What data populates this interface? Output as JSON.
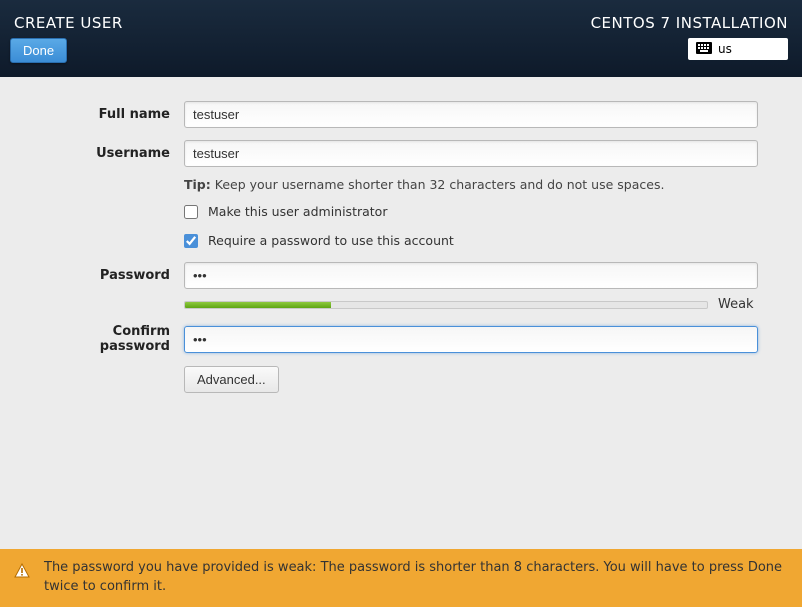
{
  "header": {
    "title": "CREATE USER",
    "subtitle": "CENTOS 7 INSTALLATION",
    "done_label": "Done",
    "keyboard_layout": "us"
  },
  "form": {
    "fullname_label": "Full name",
    "fullname_value": "testuser",
    "username_label": "Username",
    "username_value": "testuser",
    "tip_prefix": "Tip:",
    "tip_text": "Keep your username shorter than 32 characters and do not use spaces.",
    "admin_label": "Make this user administrator",
    "admin_checked": false,
    "require_pw_label": "Require a password to use this account",
    "require_pw_checked": true,
    "password_label": "Password",
    "password_value": "•••",
    "strength_pct": 28,
    "strength_label": "Weak",
    "confirm_label": "Confirm password",
    "confirm_value": "•••",
    "advanced_label": "Advanced..."
  },
  "warning": {
    "text": "The password you have provided is weak: The password is shorter than 8 characters. You will have to press Done twice to confirm it."
  }
}
